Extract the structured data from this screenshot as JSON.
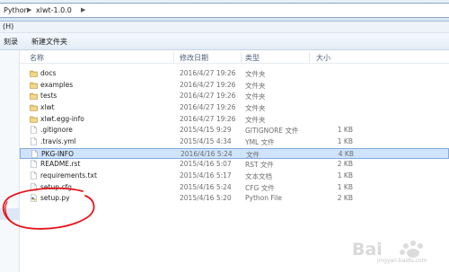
{
  "address": {
    "crumbs": [
      "Python",
      "xlwt-1.0.0"
    ]
  },
  "menu": {
    "label": "(H)"
  },
  "toolbar": {
    "burn_label": "刻录",
    "new_folder_label": "新建文件夹"
  },
  "columns": {
    "name": "名称",
    "date": "修改日期",
    "type": "类型",
    "size": "大小"
  },
  "files": [
    {
      "name": "docs",
      "date": "2016/4/27 19:26",
      "type": "文件夹",
      "size": "",
      "icon": "folder-icon"
    },
    {
      "name": "examples",
      "date": "2016/4/27 19:26",
      "type": "文件夹",
      "size": "",
      "icon": "folder-icon"
    },
    {
      "name": "tests",
      "date": "2016/4/27 19:26",
      "type": "文件夹",
      "size": "",
      "icon": "folder-icon"
    },
    {
      "name": "xlwt",
      "date": "2016/4/27 19:26",
      "type": "文件夹",
      "size": "",
      "icon": "folder-icon"
    },
    {
      "name": "xlwt.egg-info",
      "date": "2016/4/27 19:26",
      "type": "文件夹",
      "size": "",
      "icon": "folder-icon"
    },
    {
      "name": ".gitignore",
      "date": "2015/4/15 9:29",
      "type": "GITIGNORE 文件",
      "size": "1 KB",
      "icon": "file-icon"
    },
    {
      "name": ".travis.yml",
      "date": "2015/4/15 4:34",
      "type": "YML 文件",
      "size": "1 KB",
      "icon": "file-icon"
    },
    {
      "name": "PKG-INFO",
      "date": "2016/4/16 5:24",
      "type": "文件",
      "size": "4 KB",
      "icon": "file-icon"
    },
    {
      "name": "README.rst",
      "date": "2015/4/16 5:07",
      "type": "RST 文件",
      "size": "2 KB",
      "icon": "file-icon"
    },
    {
      "name": "requirements.txt",
      "date": "2015/4/16 5:17",
      "type": "文本文档",
      "size": "1 KB",
      "icon": "file-icon"
    },
    {
      "name": "setup.cfg",
      "date": "2015/4/16 5:24",
      "type": "CFG 文件",
      "size": "1 KB",
      "icon": "file-icon"
    },
    {
      "name": "setup.py",
      "date": "2015/4/16 5:20",
      "type": "Python File",
      "size": "2 KB",
      "icon": "python-file-icon"
    }
  ],
  "selected_file": "PKG-INFO",
  "colors": {
    "selection": "#cfe3fa",
    "annotation": "#e8141a"
  },
  "watermark": {
    "brand": "Bai",
    "site": "jingyan.baidu.com"
  }
}
